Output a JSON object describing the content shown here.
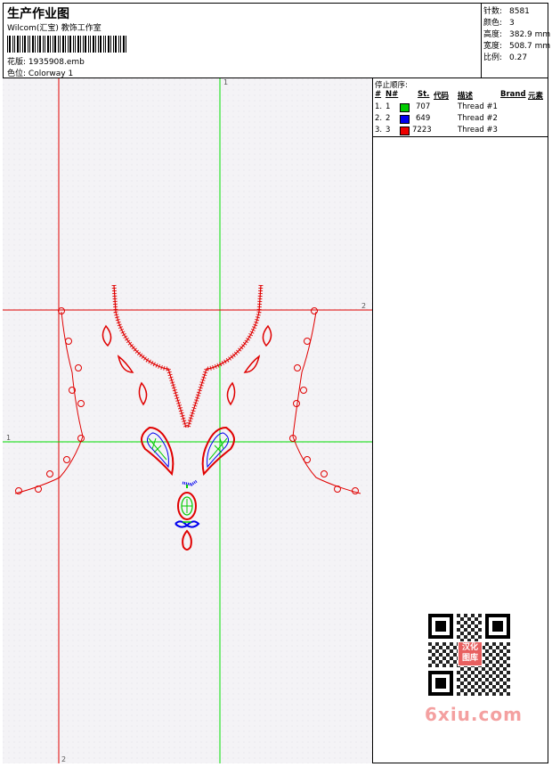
{
  "header": {
    "title": "生产作业图",
    "company": "Wilcom(汇宝) 教饰工作室",
    "design_label": "花版:",
    "design_file": "1935908.emb",
    "colorway_label": "色位:",
    "colorway": "Colorway 1"
  },
  "stats": {
    "stitches_label": "针数:",
    "stitches": "8581",
    "colors_label": "颜色:",
    "colors": "3",
    "height_label": "高度:",
    "height": "382.9 mm",
    "width_label": "宽度:",
    "width": "508.7 mm",
    "scale_label": "比例:",
    "scale": "0.27"
  },
  "guides": {
    "top_label": "1",
    "right_label": "2",
    "left_label": "1",
    "bottom_label": "2"
  },
  "thread_panel": {
    "title": "停止顺序:",
    "columns": {
      "num": "#",
      "n": "N#",
      "st": "St.",
      "code": "代码",
      "desc": "描述",
      "brand": "Brand",
      "elements": "元素"
    },
    "rows": [
      {
        "num": "1.",
        "n": "1",
        "color": "#00cc00",
        "code": "707",
        "desc": "Thread #1"
      },
      {
        "num": "2.",
        "n": "2",
        "color": "#0000ee",
        "code": "649",
        "desc": "Thread #2"
      },
      {
        "num": "3.",
        "n": "3",
        "color": "#ee0000",
        "code": "7223",
        "desc": "Thread #3"
      }
    ]
  },
  "watermark": {
    "badge": "汉化图库",
    "site": "6xiu.com"
  }
}
